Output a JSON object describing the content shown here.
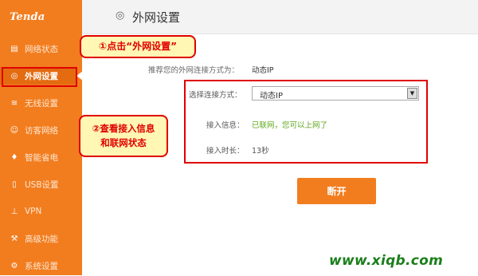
{
  "brand": {
    "logo_text": "Tenda"
  },
  "sidebar": {
    "items": [
      {
        "label": "网络状态",
        "icon": "network-status-icon"
      },
      {
        "label": "外网设置",
        "icon": "globe-icon"
      },
      {
        "label": "无线设置",
        "icon": "wifi-icon"
      },
      {
        "label": "访客网络",
        "icon": "guest-icon"
      },
      {
        "label": "智能省电",
        "icon": "power-save-icon"
      },
      {
        "label": "USB设置",
        "icon": "usb-icon"
      },
      {
        "label": "VPN",
        "icon": "vpn-icon"
      },
      {
        "label": "高级功能",
        "icon": "wrench-icon"
      },
      {
        "label": "系统设置",
        "icon": "gear-icon"
      }
    ],
    "active_index": 1
  },
  "header": {
    "title": "外网设置",
    "icon": "globe-icon"
  },
  "main": {
    "recommend_label": "推荐您的外网连接方式为：",
    "recommend_value": "动态IP",
    "connection_type_label": "选择连接方式：",
    "connection_type_value": "动态IP",
    "access_info_label": "接入信息：",
    "access_info_value": "已联网，您可以上网了",
    "access_duration_label": "接入时长：",
    "access_duration_value": "13秒",
    "disconnect_button": "断开"
  },
  "annotations": {
    "callout1": "①点击“外网设置”",
    "callout2_line1": "②查看接入信息",
    "callout2_line2": "和联网状态"
  },
  "watermark": "www.xiqb.com",
  "colors": {
    "sidebar": "#f27d1f",
    "annotation_red": "#e00000",
    "callout_fill": "#fff7b3",
    "status_green": "#5fa71e",
    "button": "#f27d1f"
  }
}
